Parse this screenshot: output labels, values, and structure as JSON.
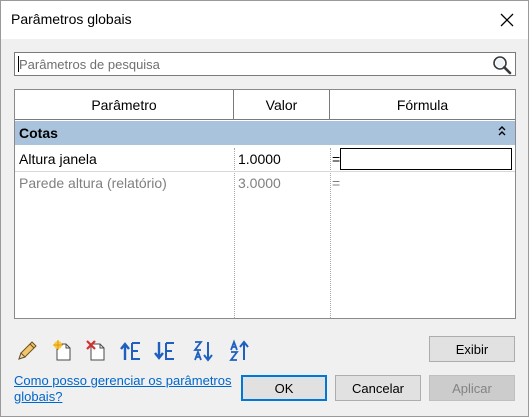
{
  "window": {
    "title": "Parâmetros globais"
  },
  "search": {
    "placeholder": "Parâmetros de pesquisa",
    "value": ""
  },
  "table": {
    "columns": [
      "Parâmetro",
      "Valor",
      "Fórmula"
    ],
    "group": {
      "label": "Cotas",
      "state": "expanded"
    },
    "rows": [
      {
        "parameter": "Altura janela",
        "value": "1.0000",
        "formula_prefix": "=",
        "formula": "",
        "reporting": false
      },
      {
        "parameter": "Parede altura (relatório)",
        "value": "3.0000",
        "formula_prefix": "=",
        "formula": "",
        "reporting": true
      }
    ]
  },
  "toolbar": {
    "icons": [
      "edit-pencil-icon",
      "new-parameter-icon",
      "delete-parameter-icon",
      "move-up-icon",
      "move-down-icon",
      "sort-ascending-icon",
      "sort-descending-icon"
    ],
    "show_label": "Exibir"
  },
  "footer": {
    "help_link": "Como posso gerenciar os parâmetros globais?",
    "ok_label": "OK",
    "cancel_label": "Cancelar",
    "apply_label": "Aplicar"
  },
  "colors": {
    "group_header": "#a9c3dc",
    "link": "#0066cc",
    "focus_border": "#0078d7",
    "dialog_bg": "#f0f0f0"
  }
}
